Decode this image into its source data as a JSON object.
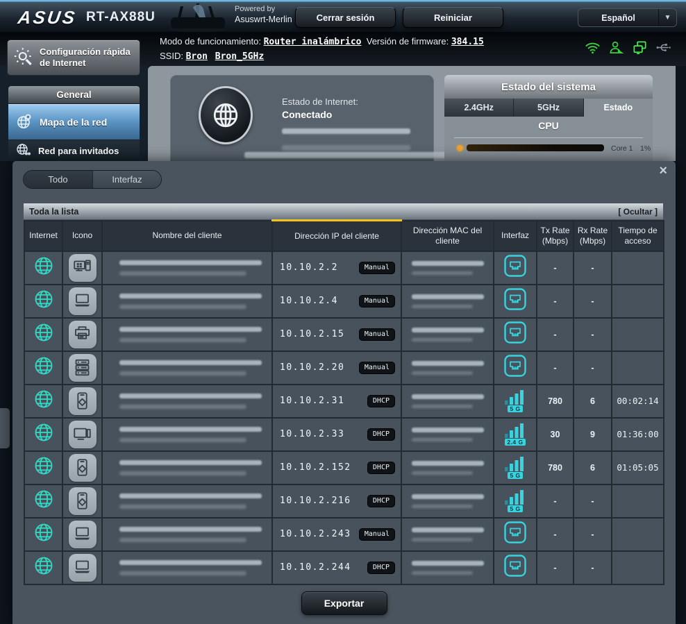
{
  "topbar": {
    "brand": "ASUS",
    "model": "RT-AX88U",
    "powered_by": "Powered by",
    "powered_by_name": "Asuswrt-Merlin",
    "logout": "Cerrar sesión",
    "reboot": "Reiniciar",
    "language": "Español",
    "language_caret": "▼"
  },
  "infobar": {
    "mode_label": "Modo de funcionamiento:",
    "mode_value": "Router inalámbrico",
    "firmware_label": "Versión de firmware:",
    "firmware_value": "384.15",
    "ssid_label": "SSID:",
    "ssid_main": "Bron",
    "ssid_5g": "Bron_5GHz",
    "status_icons": [
      "wifi-icon",
      "client-icon",
      "lan-clients-icon",
      "usb-icon"
    ]
  },
  "sidebar": {
    "quick_setup": "Configuración rápida de Internet",
    "section_general": "General",
    "items": [
      {
        "label": "Mapa de la red",
        "icon": "network-map-icon",
        "active": true
      },
      {
        "label": "Red para invitados",
        "icon": "guest-network-icon",
        "active": false
      }
    ]
  },
  "status": {
    "internet_label": "Estado de Internet:",
    "internet_value": "Conectado",
    "system_title": "Estado del sistema",
    "tabs": [
      {
        "label": "2.4GHz",
        "active": false
      },
      {
        "label": "5GHz",
        "active": false
      },
      {
        "label": "Estado",
        "active": true
      }
    ],
    "cpu_label": "CPU",
    "core_label": "Core 1",
    "core_value": "1%"
  },
  "client_panel": {
    "close_glyph": "×",
    "filter_tabs": [
      {
        "label": "Todo",
        "active": false
      },
      {
        "label": "Interfaz",
        "active": true
      }
    ],
    "list_title": "Toda la lista",
    "hide_label": "[ Ocultar ]",
    "columns": [
      "Internet",
      "Icono",
      "Nombre del cliente",
      "Dirección IP del cliente",
      "Dirección MAC del cliente",
      "Interfaz",
      "Tx Rate (Mbps)",
      "Rx Rate (Mbps)",
      "Tiempo de acceso"
    ],
    "highlighted_column": 3,
    "rows": [
      {
        "device_icon": "desktop-pc-icon",
        "ip": "10.10.2.2",
        "ip_type": "Manual",
        "interface": "wired",
        "tx": "-",
        "rx": "-",
        "time": ""
      },
      {
        "device_icon": "laptop-icon",
        "ip": "10.10.2.4",
        "ip_type": "Manual",
        "interface": "wired",
        "tx": "-",
        "rx": "-",
        "time": ""
      },
      {
        "device_icon": "printer-icon",
        "ip": "10.10.2.15",
        "ip_type": "Manual",
        "interface": "wired",
        "tx": "-",
        "rx": "-",
        "time": ""
      },
      {
        "device_icon": "server-icon",
        "ip": "10.10.2.20",
        "ip_type": "Manual",
        "interface": "wired",
        "tx": "-",
        "rx": "-",
        "time": ""
      },
      {
        "device_icon": "smartphone-icon",
        "ip": "10.10.2.31",
        "ip_type": "DHCP",
        "interface": "wifi",
        "band": "5 G",
        "tx": "780",
        "rx": "6",
        "time": "00:02:14"
      },
      {
        "device_icon": "tv-icon",
        "ip": "10.10.2.33",
        "ip_type": "DHCP",
        "interface": "wifi",
        "band": "2.4 G",
        "tx": "30",
        "rx": "9",
        "time": "01:36:00"
      },
      {
        "device_icon": "smartphone-icon",
        "ip": "10.10.2.152",
        "ip_type": "DHCP",
        "interface": "wifi",
        "band": "5 G",
        "tx": "780",
        "rx": "6",
        "time": "01:05:05"
      },
      {
        "device_icon": "smartphone-icon",
        "ip": "10.10.2.216",
        "ip_type": "DHCP",
        "interface": "wifi",
        "band": "5 G",
        "tx": "-",
        "rx": "-",
        "time": ""
      },
      {
        "device_icon": "laptop-icon",
        "ip": "10.10.2.243",
        "ip_type": "Manual",
        "interface": "wired",
        "tx": "-",
        "rx": "-",
        "time": ""
      },
      {
        "device_icon": "laptop-icon",
        "ip": "10.10.2.244",
        "ip_type": "DHCP",
        "interface": "wired",
        "tx": "-",
        "rx": "-",
        "time": ""
      }
    ],
    "export_label": "Exportar"
  },
  "colors": {
    "accent_cyan": "#38d3de",
    "globe_teal": "#35d6c2",
    "highlight_yellow": "#f6c21c",
    "status_green": "#3ecf3e",
    "active_item_blue": "#5e97c6"
  }
}
